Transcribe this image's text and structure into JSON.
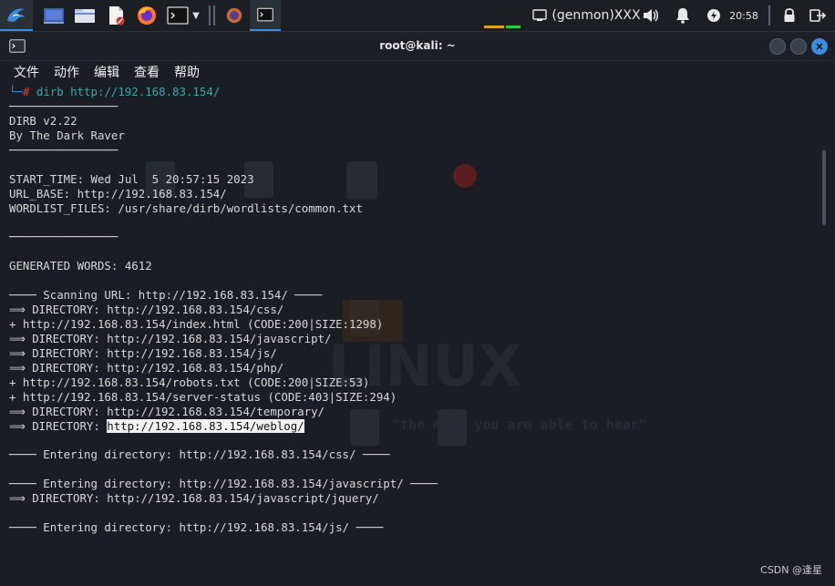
{
  "panel": {
    "genmon": "(genmon)XXX",
    "clock": "20:58"
  },
  "window": {
    "title": "root@kali: ~",
    "menu": [
      "文件",
      "动作",
      "编辑",
      "查看",
      "帮助"
    ]
  },
  "terminal": {
    "prompt_command": "dirb http://192.168.83.154/",
    "lines": [
      "────────────────",
      "DIRB v2.22",
      "By The Dark Raver",
      "────────────────",
      "",
      "START_TIME: Wed Jul  5 20:57:15 2023",
      "URL_BASE: http://192.168.83.154/",
      "WORDLIST_FILES: /usr/share/dirb/wordlists/common.txt",
      "",
      "────────────────",
      "",
      "GENERATED WORDS: 4612",
      "",
      "──── Scanning URL: http://192.168.83.154/ ────",
      "⟹ DIRECTORY: http://192.168.83.154/css/",
      "+ http://192.168.83.154/index.html (CODE:200|SIZE:1298)",
      "⟹ DIRECTORY: http://192.168.83.154/javascript/",
      "⟹ DIRECTORY: http://192.168.83.154/js/",
      "⟹ DIRECTORY: http://192.168.83.154/php/",
      "+ http://192.168.83.154/robots.txt (CODE:200|SIZE:53)",
      "+ http://192.168.83.154/server-status (CODE:403|SIZE:294)",
      "⟹ DIRECTORY: http://192.168.83.154/temporary/",
      "",
      "",
      "──── Entering directory: http://192.168.83.154/css/ ────",
      "",
      "──── Entering directory: http://192.168.83.154/javascript/ ────",
      "⟹ DIRECTORY: http://192.168.83.154/javascript/jquery/",
      "",
      "──── Entering directory: http://192.168.83.154/js/ ────"
    ],
    "selected_prefix": "⟹ DIRECTORY: ",
    "selected_text": "http://192.168.83.154/weblog/"
  },
  "watermark": "CSDN @逢星",
  "colors": {
    "accent": "#3b8de0",
    "prompt_hash": "#e53935",
    "command": "#3fa7a7"
  }
}
